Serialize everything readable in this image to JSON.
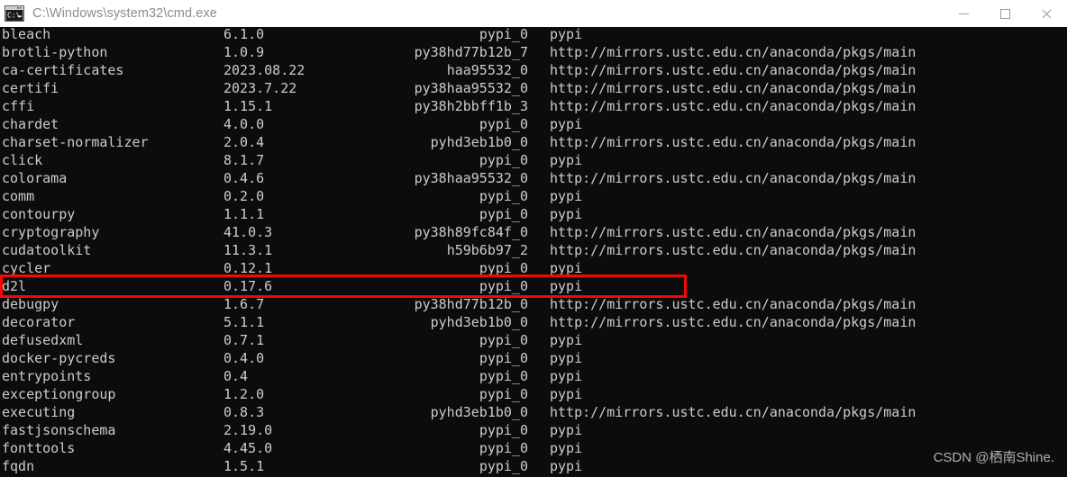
{
  "window": {
    "title": "C:\\Windows\\system32\\cmd.exe",
    "icon": "cmd-console-icon",
    "titlebar_background": "#ffffff",
    "title_color": "#8c8c8c",
    "controls": [
      {
        "name": "minimize",
        "glyph": "minimize-icon"
      },
      {
        "name": "maximize",
        "glyph": "maximize-icon"
      },
      {
        "name": "close",
        "glyph": "close-icon"
      }
    ]
  },
  "console": {
    "background": "#0c0c0c",
    "foreground": "#ccccd0",
    "rows": [
      {
        "name": "bleach",
        "version": "6.1.0",
        "build": "pypi_0",
        "channel": "pypi"
      },
      {
        "name": "brotli-python",
        "version": "1.0.9",
        "build": "py38hd77b12b_7",
        "channel": "http://mirrors.ustc.edu.cn/anaconda/pkgs/main"
      },
      {
        "name": "ca-certificates",
        "version": "2023.08.22",
        "build": "haa95532_0",
        "channel": "http://mirrors.ustc.edu.cn/anaconda/pkgs/main"
      },
      {
        "name": "certifi",
        "version": "2023.7.22",
        "build": "py38haa95532_0",
        "channel": "http://mirrors.ustc.edu.cn/anaconda/pkgs/main"
      },
      {
        "name": "cffi",
        "version": "1.15.1",
        "build": "py38h2bbff1b_3",
        "channel": "http://mirrors.ustc.edu.cn/anaconda/pkgs/main"
      },
      {
        "name": "chardet",
        "version": "4.0.0",
        "build": "pypi_0",
        "channel": "pypi"
      },
      {
        "name": "charset-normalizer",
        "version": "2.0.4",
        "build": "pyhd3eb1b0_0",
        "channel": "http://mirrors.ustc.edu.cn/anaconda/pkgs/main"
      },
      {
        "name": "click",
        "version": "8.1.7",
        "build": "pypi_0",
        "channel": "pypi"
      },
      {
        "name": "colorama",
        "version": "0.4.6",
        "build": "py38haa95532_0",
        "channel": "http://mirrors.ustc.edu.cn/anaconda/pkgs/main"
      },
      {
        "name": "comm",
        "version": "0.2.0",
        "build": "pypi_0",
        "channel": "pypi"
      },
      {
        "name": "contourpy",
        "version": "1.1.1",
        "build": "pypi_0",
        "channel": "pypi"
      },
      {
        "name": "cryptography",
        "version": "41.0.3",
        "build": "py38h89fc84f_0",
        "channel": "http://mirrors.ustc.edu.cn/anaconda/pkgs/main"
      },
      {
        "name": "cudatoolkit",
        "version": "11.3.1",
        "build": "h59b6b97_2",
        "channel": "http://mirrors.ustc.edu.cn/anaconda/pkgs/main"
      },
      {
        "name": "cycler",
        "version": "0.12.1",
        "build": "pypi_0",
        "channel": "pypi"
      },
      {
        "name": "d2l",
        "version": "0.17.6",
        "build": "pypi_0",
        "channel": "pypi"
      },
      {
        "name": "debugpy",
        "version": "1.6.7",
        "build": "py38hd77b12b_0",
        "channel": "http://mirrors.ustc.edu.cn/anaconda/pkgs/main"
      },
      {
        "name": "decorator",
        "version": "5.1.1",
        "build": "pyhd3eb1b0_0",
        "channel": "http://mirrors.ustc.edu.cn/anaconda/pkgs/main"
      },
      {
        "name": "defusedxml",
        "version": "0.7.1",
        "build": "pypi_0",
        "channel": "pypi"
      },
      {
        "name": "docker-pycreds",
        "version": "0.4.0",
        "build": "pypi_0",
        "channel": "pypi"
      },
      {
        "name": "entrypoints",
        "version": "0.4",
        "build": "pypi_0",
        "channel": "pypi"
      },
      {
        "name": "exceptiongroup",
        "version": "1.2.0",
        "build": "pypi_0",
        "channel": "pypi"
      },
      {
        "name": "executing",
        "version": "0.8.3",
        "build": "pyhd3eb1b0_0",
        "channel": "http://mirrors.ustc.edu.cn/anaconda/pkgs/main"
      },
      {
        "name": "fastjsonschema",
        "version": "2.19.0",
        "build": "pypi_0",
        "channel": "pypi"
      },
      {
        "name": "fonttools",
        "version": "4.45.0",
        "build": "pypi_0",
        "channel": "pypi"
      },
      {
        "name": "fqdn",
        "version": "1.5.1",
        "build": "pypi_0",
        "channel": "pypi"
      }
    ]
  },
  "annotation": {
    "highlight_color": "#fb0404",
    "highlighted_row_index": 14,
    "highlighted_row_text": "d2l                       0.17.6                   pypi_0    pypi"
  },
  "watermark": {
    "text": "CSDN @栖南Shine."
  }
}
